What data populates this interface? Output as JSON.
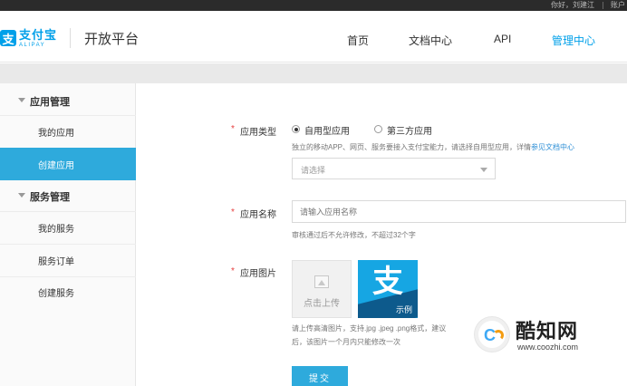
{
  "topbar": {
    "user": "你好，刘建江",
    "account": "账户"
  },
  "header": {
    "logo_cn": "支付宝",
    "logo_en": "ALIPAY",
    "logo_mark": "支",
    "platform": "开放平台",
    "nav": [
      "首页",
      "文档中心",
      "API",
      "管理中心"
    ],
    "active_nav": "管理中心"
  },
  "sidebar": {
    "groups": [
      {
        "label": "应用管理",
        "items": [
          "我的应用",
          "创建应用"
        ]
      },
      {
        "label": "服务管理",
        "items": [
          "我的服务",
          "服务订单",
          "创建服务"
        ]
      }
    ],
    "active_item": "创建应用"
  },
  "form": {
    "app_type": {
      "label": "应用类型",
      "options": [
        "自用型应用",
        "第三方应用"
      ],
      "selected": "自用型应用",
      "hint": "独立的移动APP、网页、服务要接入支付宝能力，请选择自用型应用，详情",
      "hint_link": "参见文档中心",
      "select_placeholder": "请选择"
    },
    "app_name": {
      "label": "应用名称",
      "placeholder": "请输入应用名称",
      "hint": "审核通过后不允许修改，不超过32个字"
    },
    "app_image": {
      "label": "应用图片",
      "upload_label": "点击上传",
      "sample_glyph": "支",
      "sample_caption": "示例",
      "hint_line1": "请上传高清图片，支持.jpg .jpeg .png格式，建议",
      "hint_line2": "后，该图片一个月内只能修改一次"
    },
    "submit_label": "提交"
  },
  "watermark": {
    "name": "酷知网",
    "url": "www.coozhi.com"
  },
  "colors": {
    "accent": "#2eaadc",
    "brand": "#00a0e9",
    "required": "#e63e3e"
  }
}
